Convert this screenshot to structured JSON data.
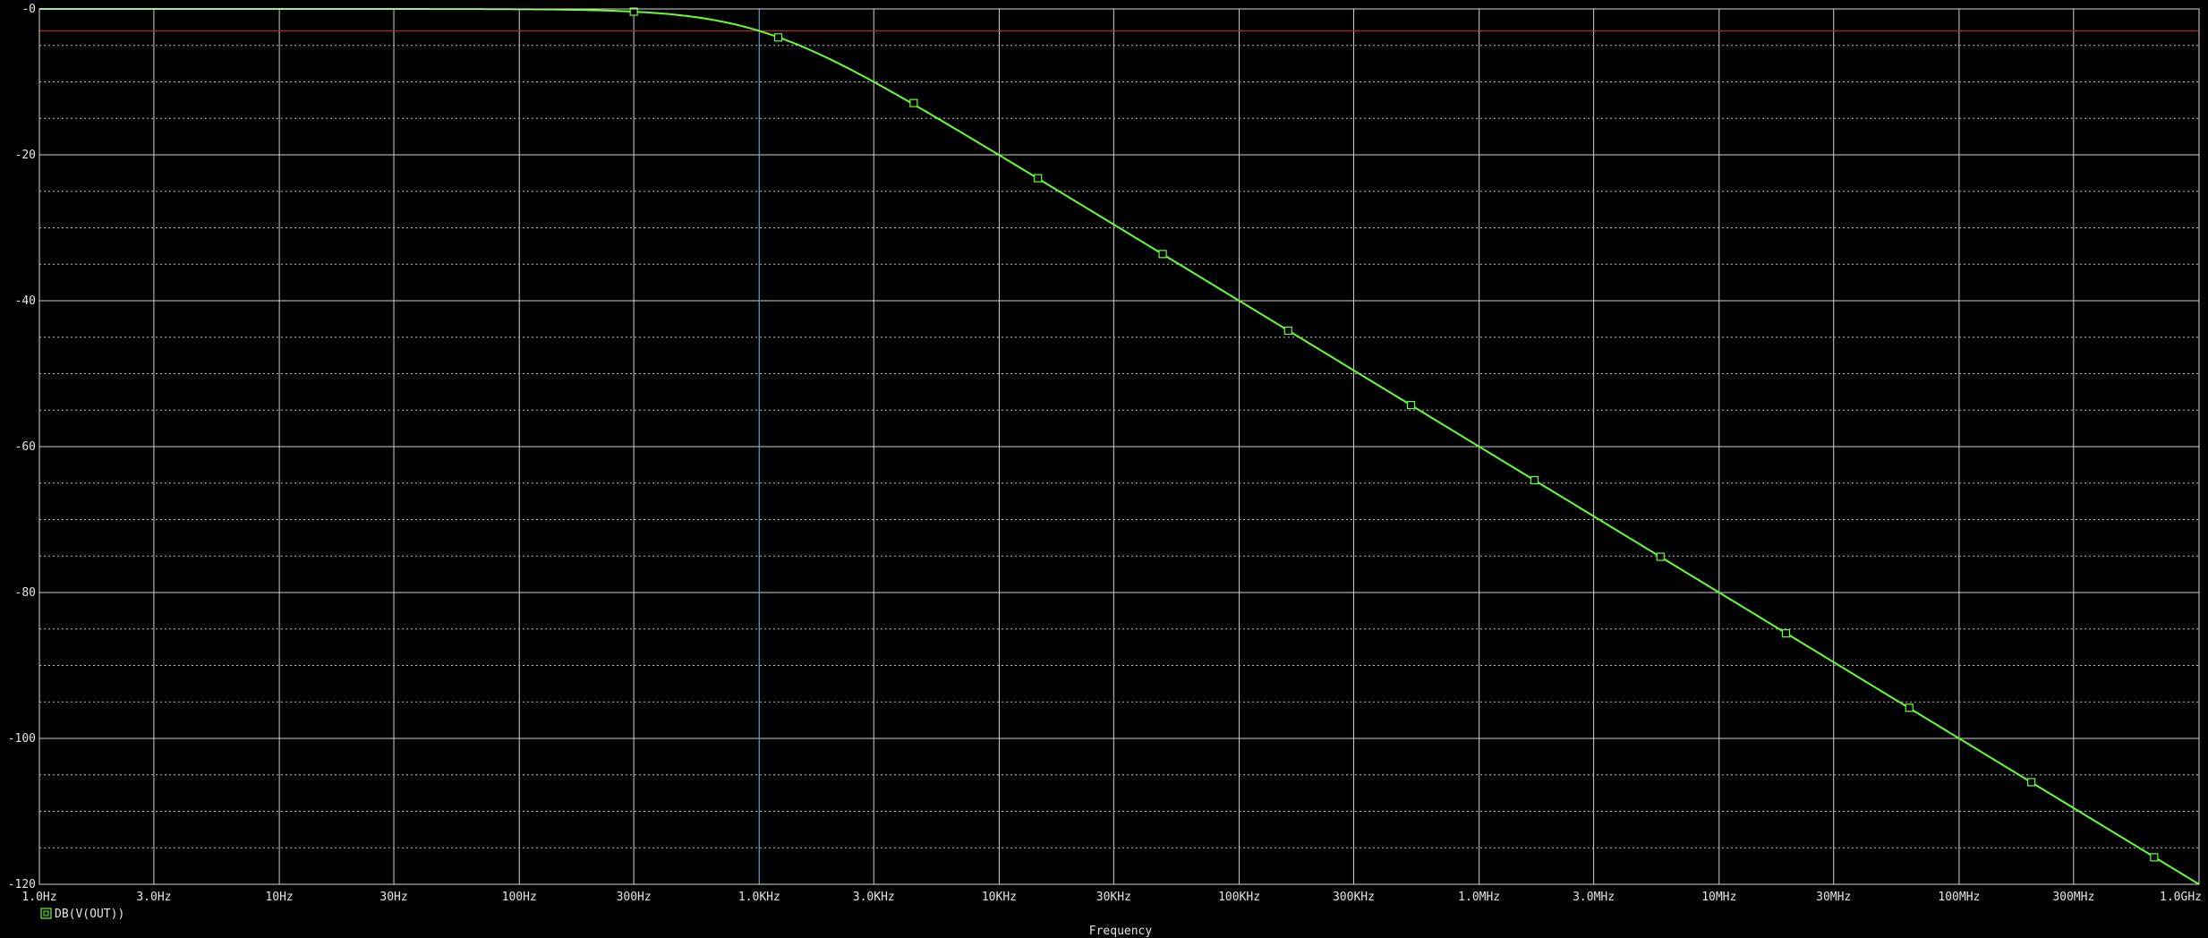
{
  "colors": {
    "background": "#000000",
    "trace": "#66ff33",
    "reference_line": "#c81e1e",
    "cursor_line": "#4a8fbf",
    "grid": "#cfcfcf",
    "text": "#e6e6e6"
  },
  "chart_data": {
    "type": "line",
    "title": "",
    "xlabel": "Frequency",
    "ylabel": "",
    "x_scale": "log",
    "xlim": [
      1,
      1000000000
    ],
    "ylim": [
      -120,
      0
    ],
    "grid": true,
    "legend_position": "bottom-left",
    "x_ticks": [
      {
        "value": 1,
        "label": "1.0Hz"
      },
      {
        "value": 3,
        "label": "3.0Hz"
      },
      {
        "value": 10,
        "label": "10Hz"
      },
      {
        "value": 30,
        "label": "30Hz"
      },
      {
        "value": 100,
        "label": "100Hz"
      },
      {
        "value": 300,
        "label": "300Hz"
      },
      {
        "value": 1000,
        "label": "1.0KHz"
      },
      {
        "value": 3000,
        "label": "3.0KHz"
      },
      {
        "value": 10000,
        "label": "10KHz"
      },
      {
        "value": 30000,
        "label": "30KHz"
      },
      {
        "value": 100000,
        "label": "100KHz"
      },
      {
        "value": 300000,
        "label": "300KHz"
      },
      {
        "value": 1000000,
        "label": "1.0MHz"
      },
      {
        "value": 3000000,
        "label": "3.0MHz"
      },
      {
        "value": 10000000,
        "label": "10MHz"
      },
      {
        "value": 30000000,
        "label": "30MHz"
      },
      {
        "value": 100000000,
        "label": "100MHz"
      },
      {
        "value": 300000000,
        "label": "300MHz"
      },
      {
        "value": 1000000000,
        "label": "1.0GHz"
      }
    ],
    "y_ticks": [
      {
        "value": 0,
        "label": "-0"
      },
      {
        "value": -20,
        "label": "-20"
      },
      {
        "value": -40,
        "label": "-40"
      },
      {
        "value": -60,
        "label": "-60"
      },
      {
        "value": -80,
        "label": "-80"
      },
      {
        "value": -100,
        "label": "-100"
      },
      {
        "value": -120,
        "label": "-120"
      }
    ],
    "y_minor_step": 5,
    "reference_line_y": -3,
    "cursor_x": 1000,
    "series": [
      {
        "name": "DB(V(OUT))",
        "marker": "square",
        "corner_frequency": 1000,
        "x": [
          1,
          3,
          10,
          30,
          100,
          200,
          300,
          500,
          700,
          1000,
          1500,
          2000,
          3000,
          5000,
          10000,
          30000,
          100000,
          1000000,
          10000000,
          100000000,
          1000000000
        ],
        "y": [
          0,
          0,
          0,
          0,
          -0.04,
          -0.17,
          -0.37,
          -0.97,
          -1.7,
          -3.0,
          -5.1,
          -7.0,
          -10.0,
          -14.1,
          -20.0,
          -29.5,
          -40.0,
          -60.0,
          -80.0,
          -100.0,
          -120.0
        ],
        "markers_x": [
          300,
          1200,
          4400,
          14500,
          48000,
          160000,
          520000,
          1700000,
          5700000,
          19000000,
          62000000,
          200000000,
          650000000
        ],
        "markers_y": [
          -0.37,
          -3.9,
          -12.9,
          -23.2,
          -33.6,
          -44.1,
          -54.3,
          -64.6,
          -75.1,
          -85.6,
          -95.8,
          -106.0,
          -116.3
        ]
      }
    ]
  }
}
